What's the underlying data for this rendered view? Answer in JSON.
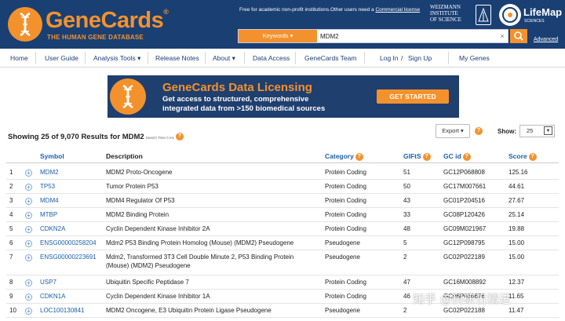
{
  "header": {
    "logo_title": "GeneCards",
    "logo_reg": "®",
    "logo_subtitle": "THE HUMAN GENE DATABASE",
    "free_note": "Free for academic non-profit institutions.Other users need a",
    "free_note_link": "Commercial license",
    "weizmann": [
      "WEIZMANN",
      "INSTITUTE",
      "OF SCIENCE"
    ],
    "lifemap_name": "LifeMap",
    "lifemap_sub": "SCIENCES",
    "keywords_label": "Keywords ▾",
    "search_value": "MDM2",
    "clear_symbol": "×",
    "advanced_label": "Advanced"
  },
  "nav": {
    "items": [
      "Home",
      "User Guide",
      "Analysis Tools ▾",
      "Release Notes",
      "About ▾",
      "Data Access",
      "GeneCards Team",
      "Log In",
      "/",
      "Sign Up",
      "My Genes"
    ]
  },
  "banner": {
    "title": "GeneCards Data Licensing",
    "text": "Get access to structured, comprehensive integrated data from >150 biomedical sources",
    "button": "GET STARTED"
  },
  "results": {
    "title": "Showing 25 of 9,070 Results for MDM2",
    "search_time": "Search Time 0 ms",
    "export_label": "Export ▾",
    "show_label": "Show:",
    "show_value": "25",
    "show_arrow": "▼"
  },
  "table": {
    "columns": [
      "Symbol",
      "Description",
      "Category",
      "GIFtS",
      "GC id",
      "Score"
    ],
    "rows": [
      {
        "n": "1",
        "symbol": "MDM2",
        "description": [
          "MDM2 Proto-Oncogene"
        ],
        "category": "Protein Coding",
        "gifts": "51",
        "gcid": "GC12P068808",
        "score": "125.16"
      },
      {
        "n": "2",
        "symbol": "TP53",
        "description": [
          "Tumor Protein P53"
        ],
        "category": "Protein Coding",
        "gifts": "50",
        "gcid": "GC17M007661",
        "score": "44.61"
      },
      {
        "n": "3",
        "symbol": "MDM4",
        "description": [
          "MDM4 Regulator Of P53"
        ],
        "category": "Protein Coding",
        "gifts": "43",
        "gcid": "GC01P204516",
        "score": "27.67"
      },
      {
        "n": "4",
        "symbol": "MTBP",
        "description": [
          "MDM2 Binding Protein"
        ],
        "category": "Protein Coding",
        "gifts": "33",
        "gcid": "GC08P120426",
        "score": "25.14"
      },
      {
        "n": "5",
        "symbol": "CDKN2A",
        "description": [
          "Cyclin Dependent Kinase Inhibitor 2A"
        ],
        "category": "Protein Coding",
        "gifts": "48",
        "gcid": "GC09M021967",
        "score": "19.88"
      },
      {
        "n": "6",
        "symbol": "ENSG00000258204",
        "description": [
          "Mdm2 P53 Binding Protein Homolog (Mouse) (MDM2) Pseudogene"
        ],
        "category": "Pseudogene",
        "gifts": "5",
        "gcid": "GC12P098795",
        "score": "15.00"
      },
      {
        "n": "7",
        "symbol": "ENSG00000223691",
        "description": [
          "Mdm2, Transformed 3T3 Cell Double Minute 2, P53 Binding Protein",
          "(Mouse) (MDM2) Pseudogene"
        ],
        "category": "Pseudogene",
        "gifts": "2",
        "gcid": "GC02P022189",
        "score": "15.00"
      },
      {
        "n": "8",
        "symbol": "USP7",
        "description": [
          "Ubiquitin Specific Peptidase 7"
        ],
        "category": "Protein Coding",
        "gifts": "47",
        "gcid": "GC16M008892",
        "score": "12.37"
      },
      {
        "n": "9",
        "symbol": "CDKN1A",
        "description": [
          "Cyclin Dependent Kinase Inhibitor 1A"
        ],
        "category": "Protein Coding",
        "gifts": "46",
        "gcid": "GC06P036676",
        "score": "11.65"
      },
      {
        "n": "10",
        "symbol": "LOC100130841",
        "description": [
          "MDM2 Oncogene, E3 Ubiquitin Protein Ligase Pseudogene"
        ],
        "category": "Pseudogene",
        "gifts": "2",
        "gcid": "GC02P022188",
        "score": "11.47"
      }
    ]
  },
  "watermark": "知乎 @科研日精进",
  "colors": {
    "header_bg": "#1a3f73",
    "accent": "#f3922d",
    "link": "#1b5fa8"
  }
}
